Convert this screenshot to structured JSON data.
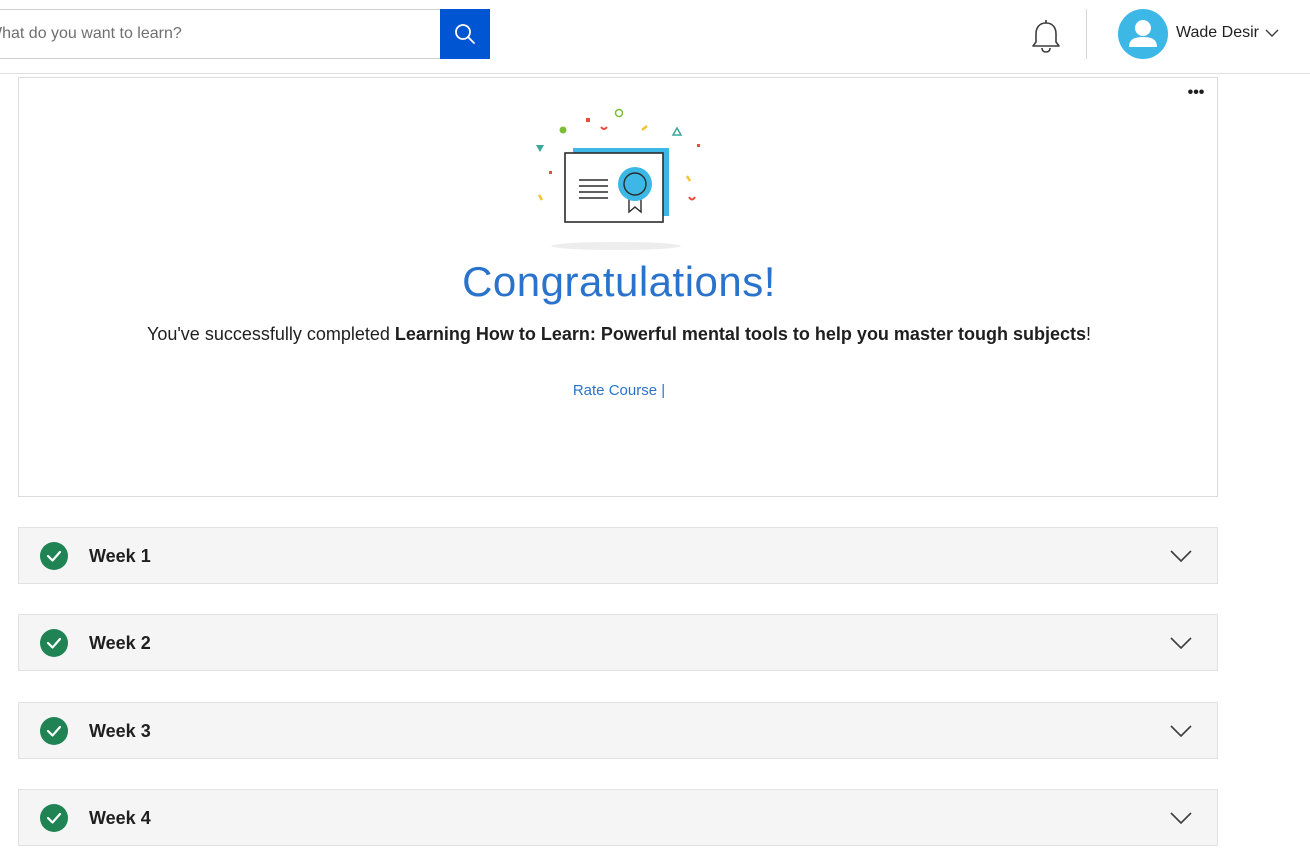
{
  "header": {
    "search": {
      "placeholder": "What do you want to learn?"
    },
    "user": {
      "name": "Wade Desir"
    }
  },
  "congrats": {
    "title": "Congratulations!",
    "message_prefix": "You've successfully completed ",
    "course_name": "Learning How to Learn: Powerful mental tools to help you master tough subjects",
    "message_suffix": "!",
    "rate_label": "Rate Course",
    "rate_separator": " |"
  },
  "weeks": [
    {
      "label": "Week 1",
      "status": "completed"
    },
    {
      "label": "Week 2",
      "status": "completed"
    },
    {
      "label": "Week 3",
      "status": "completed"
    },
    {
      "label": "Week 4",
      "status": "completed"
    }
  ],
  "colors": {
    "brand_blue": "#0056d2",
    "title_blue": "#2a73cc",
    "avatar": "#3db8e6",
    "complete_green": "#1f8354"
  },
  "icons": {
    "search": "search-icon",
    "bell": "bell-icon",
    "avatar": "user-avatar-icon",
    "chevron": "chevron-down-icon",
    "check": "check-circle-icon",
    "more": "more-dots-icon",
    "certificate": "certificate-illustration"
  }
}
